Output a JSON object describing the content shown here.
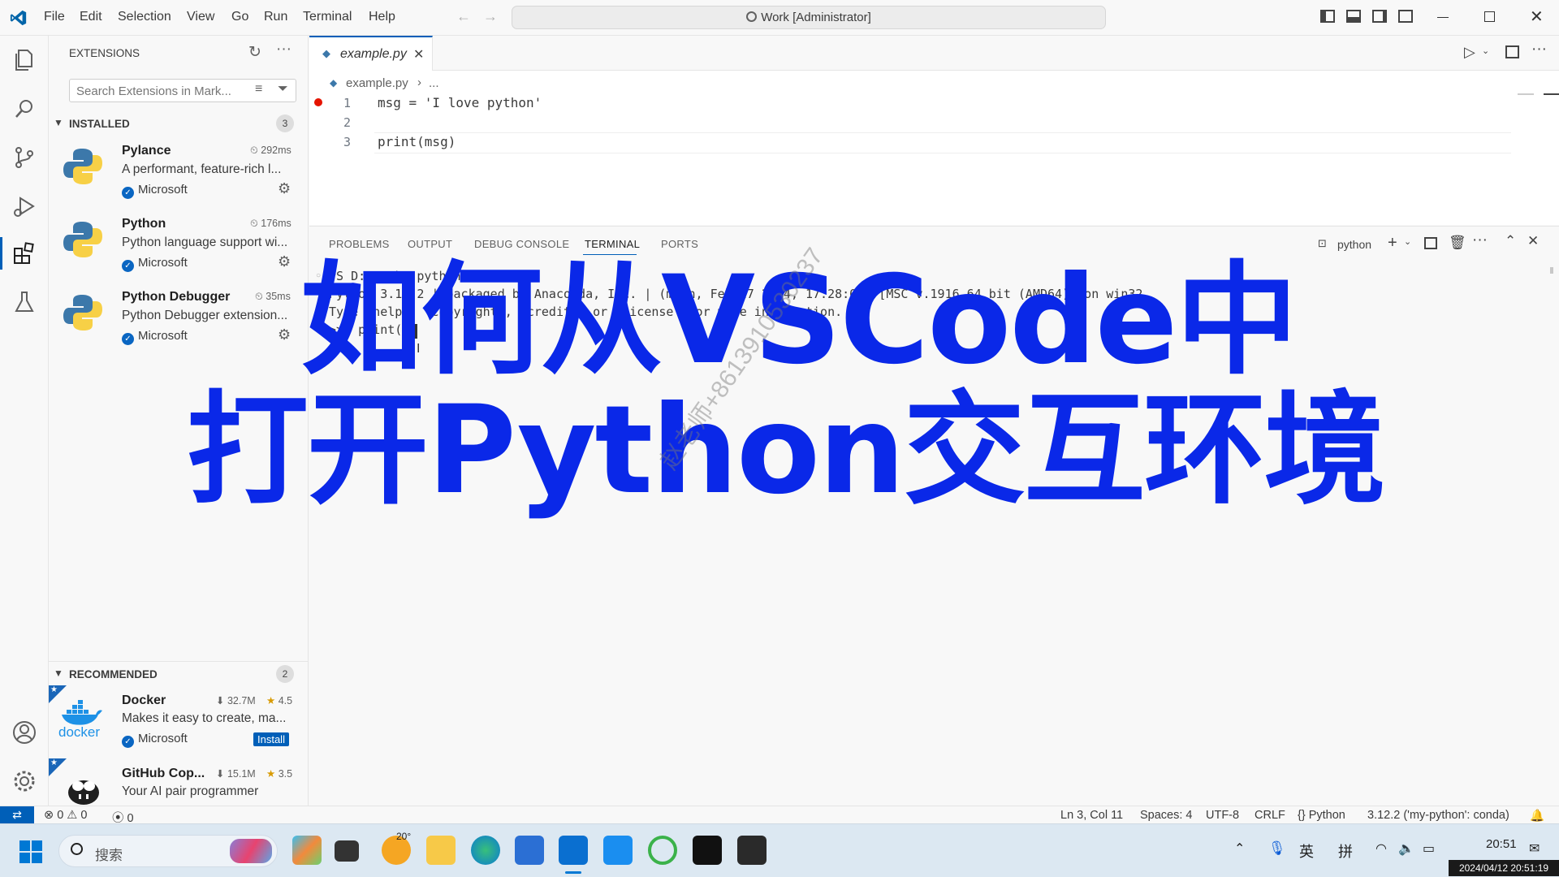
{
  "titlebar": {
    "menus": [
      "File",
      "Edit",
      "Selection",
      "View",
      "Go",
      "Run",
      "Terminal",
      "Help"
    ],
    "command_center": "Work [Administrator]"
  },
  "sidebar": {
    "title": "EXTENSIONS",
    "search_placeholder": "Search Extensions in Mark...",
    "installed": {
      "label": "INSTALLED",
      "count": "3",
      "items": [
        {
          "name": "Pylance",
          "time": "292ms",
          "desc": "A performant, feature-rich l...",
          "publisher": "Microsoft"
        },
        {
          "name": "Python",
          "time": "176ms",
          "desc": "Python language support wi...",
          "publisher": "Microsoft"
        },
        {
          "name": "Python Debugger",
          "time": "35ms",
          "desc": "Python Debugger extension...",
          "publisher": "Microsoft"
        }
      ]
    },
    "recommended": {
      "label": "RECOMMENDED",
      "count": "2",
      "items": [
        {
          "name": "Docker",
          "downloads": "32.7M",
          "rating": "4.5",
          "desc": "Makes it easy to create, ma...",
          "publisher": "Microsoft",
          "install": "Install",
          "logo_text": "docker"
        },
        {
          "name": "GitHub Cop...",
          "downloads": "15.1M",
          "rating": "3.5",
          "desc": "Your AI pair programmer"
        }
      ]
    }
  },
  "editor": {
    "tab": "example.py",
    "breadcrumb_file": "example.py",
    "breadcrumb_more": "...",
    "lines": [
      {
        "n": "1",
        "text": "msg = 'I love python'"
      },
      {
        "n": "2",
        "text": ""
      },
      {
        "n": "3",
        "text": "print(msg)"
      }
    ]
  },
  "panel": {
    "tabs": [
      "PROBLEMS",
      "OUTPUT",
      "DEBUG CONSOLE",
      "TERMINAL",
      "PORTS"
    ],
    "active_tab": "TERMINAL",
    "terminal_name": "python",
    "lines": [
      "PS D:\\Work> python",
      "Python 3.12.2 | packaged by Anaconda, Inc. | (main, Feb 27 2024, 17:28:07) [MSC v.1916 64 bit (AMD64)] on win32",
      "Type \"help\", \"copyright\", \"credits\" or \"license\" for more information.",
      ">>> print()"
    ]
  },
  "statusbar": {
    "errors": "0",
    "warnings": "0",
    "ports": "0",
    "position": "Ln 3, Col 11",
    "spaces": "Spaces: 4",
    "encoding": "UTF-8",
    "eol": "CRLF",
    "language": "Python",
    "interpreter": "3.12.2 ('my-python': conda)"
  },
  "taskbar": {
    "search": "搜索",
    "weather": "20°",
    "ime1": "英",
    "ime2": "拼",
    "time": "20:51",
    "timestamp": "2024/04/12 20:51:19"
  },
  "overlay": {
    "line1": "如何从VSCode中",
    "line2": "打开Python交互环境",
    "watermark": "赵老师+8613910530237"
  },
  "colors": {
    "accent": "#005fb8",
    "overlay_text": "#0a28e8",
    "breakpoint": "#e51400"
  }
}
